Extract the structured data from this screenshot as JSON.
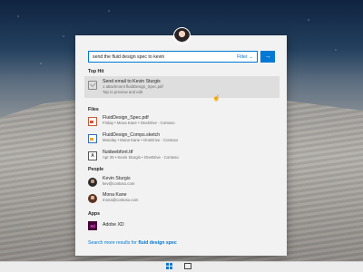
{
  "search": {
    "query": "send the fluid design spec to kevin",
    "filter_label": "Filter",
    "go_glyph": "→"
  },
  "sections": {
    "top_hit": "Top Hit",
    "files": "Files",
    "people": "People",
    "apps": "Apps"
  },
  "top_hit": {
    "title": "Send email to Kevin Sturgis",
    "subtitle": "1 attachment fluidDesign_Spec.pdf",
    "hint": "Tap to preview and edit",
    "icon": "mail-icon"
  },
  "files": [
    {
      "name": "FluidDesign_Spec.pdf",
      "meta": "Friday • Mona Kane • OneDrive - Contoso",
      "icon": "pdf-icon"
    },
    {
      "name": "FluidDesign_Comps.sketch",
      "meta": "Monday • Mona Kane • OneDrive - Contoso",
      "icon": "sketch-icon"
    },
    {
      "name": "fluidwebfont.ttf",
      "meta": "Apr 25 • Kevin Sturgis • OneDrive - Contoso",
      "icon": "ttf-icon"
    }
  ],
  "people": [
    {
      "name": "Kevin Sturgis",
      "email": "kev@contoso.com"
    },
    {
      "name": "Mona Kane",
      "email": "mona@contoso.com"
    }
  ],
  "apps": [
    {
      "name": "Adobe XD",
      "badge": "Xd"
    }
  ],
  "more": {
    "prefix": "Search more results for ",
    "term": "fluid design spec"
  },
  "colors": {
    "accent": "#0078d4",
    "panel": "#f2f2f2",
    "highlight": "#dedede"
  }
}
